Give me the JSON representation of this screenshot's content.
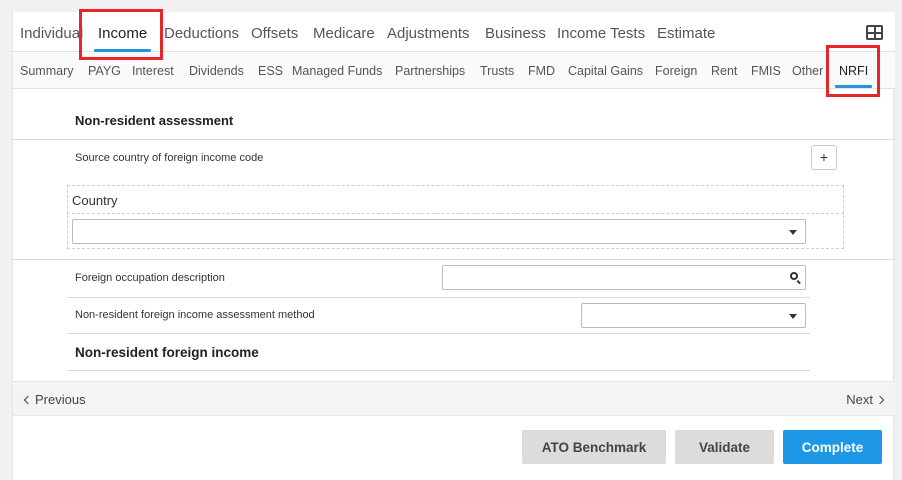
{
  "main_tabs": [
    {
      "label": "Individual",
      "active": false
    },
    {
      "label": "Income",
      "active": true
    },
    {
      "label": "Deductions",
      "active": false
    },
    {
      "label": "Offsets",
      "active": false
    },
    {
      "label": "Medicare",
      "active": false
    },
    {
      "label": "Adjustments",
      "active": false
    },
    {
      "label": "Business",
      "active": false
    },
    {
      "label": "Income Tests",
      "active": false
    },
    {
      "label": "Estimate",
      "active": false
    }
  ],
  "sub_tabs": [
    {
      "label": "Summary",
      "active": false
    },
    {
      "label": "PAYG",
      "active": false
    },
    {
      "label": "Interest",
      "active": false
    },
    {
      "label": "Dividends",
      "active": false
    },
    {
      "label": "ESS",
      "active": false
    },
    {
      "label": "Managed Funds",
      "active": false
    },
    {
      "label": "Partnerships",
      "active": false
    },
    {
      "label": "Trusts",
      "active": false
    },
    {
      "label": "FMD",
      "active": false
    },
    {
      "label": "Capital Gains",
      "active": false
    },
    {
      "label": "Foreign",
      "active": false
    },
    {
      "label": "Rent",
      "active": false
    },
    {
      "label": "FMIS",
      "active": false
    },
    {
      "label": "Other",
      "active": false
    },
    {
      "label": "NRFI",
      "active": true
    }
  ],
  "form": {
    "section1_title": "Non-resident assessment",
    "source_country_label": "Source country of foreign income code",
    "add_button": "+",
    "country_header": "Country",
    "country_value": "",
    "occupation_label": "Foreign occupation description",
    "occupation_value": "",
    "method_label": "Non-resident foreign income assessment method",
    "method_value": "",
    "section2_title": "Non-resident foreign income"
  },
  "nav": {
    "previous": "Previous",
    "next": "Next"
  },
  "actions": {
    "ato_benchmark": "ATO Benchmark",
    "validate": "Validate",
    "complete": "Complete"
  },
  "colors": {
    "accent": "#2196d8",
    "highlight": "#e8252a",
    "primary_button": "#1e98e6"
  }
}
